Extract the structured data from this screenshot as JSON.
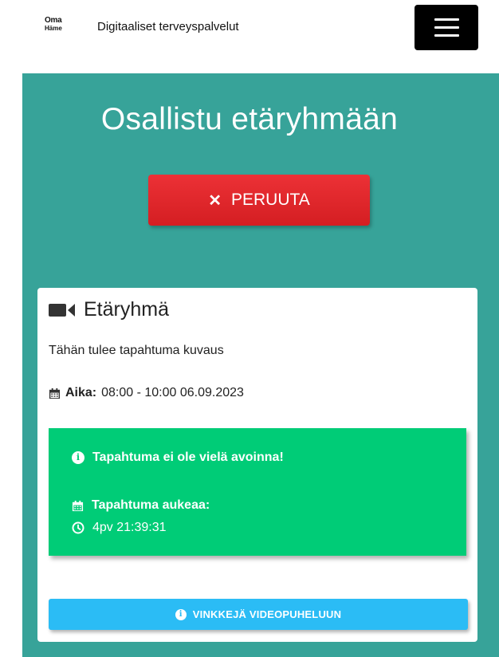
{
  "header": {
    "logo_line1": "Oma",
    "logo_line2": "Häme",
    "site_title": "Digitaaliset terveyspalvelut"
  },
  "main": {
    "page_title": "Osallistu etäryhmään",
    "cancel_label": "PERUUTA"
  },
  "event": {
    "title": "Etäryhmä",
    "description": "Tähän tulee tapahtuma kuvaus",
    "time_label": "Aika:",
    "time_value": "08:00 - 10:00 06.09.2023",
    "status": {
      "not_open_text": "Tapahtuma ei ole vielä avoinna!",
      "opens_label": "Tapahtuma aukeaa:",
      "countdown": "4pv 21:39:31"
    },
    "tips_label": "VINKKEJÄ VIDEOPUHELUUN"
  },
  "colors": {
    "teal": "#37a399",
    "red": "#e0262b",
    "green": "#00cc77",
    "blue": "#2bbcf5"
  }
}
